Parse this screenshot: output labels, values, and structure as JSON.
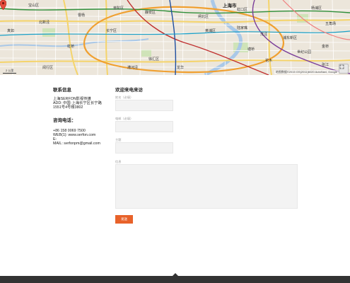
{
  "map": {
    "city_label": "上海市",
    "district_labels": [
      "静安区",
      "虹口区",
      "浦东新区",
      "长宁区",
      "徐汇区",
      "普陀区",
      "闸北区",
      "黄浦区",
      "杨浦区",
      "闵行区",
      "宝山区",
      "陆家嘴",
      "世纪公园",
      "龙华",
      "漕河泾",
      "虹桥",
      "北新泾",
      "真如",
      "曹杨",
      "五角场",
      "花木",
      "张江",
      "金桥",
      "洋泾",
      "塘桥"
    ],
    "attribution": "地图数据©2015 GS(2011)6020 AutoNavi, Google",
    "scale": "2 公里",
    "accent_pin": "#e74c3c"
  },
  "contact": {
    "title": "联系信息",
    "company": "上海SERFON影视传媒",
    "address_1": "ADD: 中国·上海长宁区长宁路",
    "address_2": "1551号4号楼3802",
    "phone_title": "咨询电话：",
    "phone": "+86 158 0069 7500",
    "web": "WEB(1): www.serfon.com",
    "e_label": "E-",
    "mail": "MAIL: serfonpm@gmail.com"
  },
  "form": {
    "title": "欢迎来电来访",
    "name_label": "姓名（必填）",
    "email_label": "电邮（必填）",
    "subject_label": "主题",
    "message_label": "信息",
    "submit_label": "发送",
    "submit_color": "#e8622a"
  },
  "footer": {
    "color": "#333333"
  }
}
